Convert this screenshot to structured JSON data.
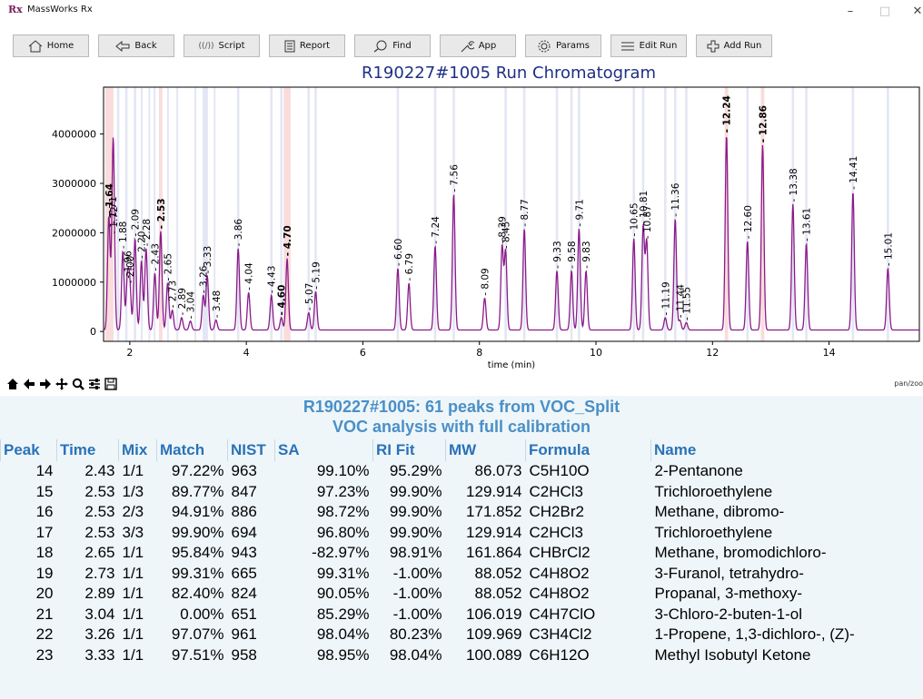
{
  "window": {
    "app_icon": "Rx",
    "title": "MassWorks Rx",
    "controls": {
      "minimize": "–",
      "maximize": "□",
      "close": "✕"
    }
  },
  "toolbar": {
    "buttons": [
      {
        "label": "Home",
        "icon": "home-icon"
      },
      {
        "label": "Back",
        "icon": "back-arrow-icon"
      },
      {
        "label": "Script",
        "icon": "script-icon"
      },
      {
        "label": "Report",
        "icon": "report-icon"
      },
      {
        "label": "Find",
        "icon": "search-icon"
      },
      {
        "label": "App",
        "icon": "wrench-icon"
      },
      {
        "label": "Params",
        "icon": "gear-icon"
      },
      {
        "label": "Edit Run",
        "icon": "list-icon"
      },
      {
        "label": "Add Run",
        "icon": "plus-icon"
      }
    ]
  },
  "chart": {
    "title": "R190227#1005 Run Chromatogram",
    "colors": {
      "trace": "#8b1a8b",
      "blue_band": "#e3e6f4",
      "red_band": "#fadcdc"
    }
  },
  "chart_data": {
    "type": "line",
    "title": "R190227#1005 Run Chromatogram",
    "xlabel": "time (min)",
    "ylabel": "",
    "xlim": [
      1.55,
      15.55
    ],
    "ylim": [
      -200000,
      4950000
    ],
    "x_ticks": [
      2,
      4,
      6,
      8,
      10,
      12,
      14
    ],
    "y_ticks": [
      0,
      1000000,
      2000000,
      3000000,
      4000000
    ],
    "y_tick_labels": [
      "0",
      "1000000",
      "2000000",
      "3000000",
      "4000000"
    ],
    "grid": false,
    "legend": "none",
    "peaks": [
      {
        "label": "1.64",
        "t": 1.64,
        "h": 2300000,
        "bold": true
      },
      {
        "label": "1.71",
        "t": 1.71,
        "h": 2100000
      },
      {
        "label": "1.72",
        "t": 1.72,
        "h": 1900000
      },
      {
        "label": "1.88",
        "t": 1.88,
        "h": 1600000
      },
      {
        "label": "1.96",
        "t": 1.96,
        "h": 1000000
      },
      {
        "label": "2.00",
        "t": 2.0,
        "h": 900000
      },
      {
        "label": "2.09",
        "t": 2.09,
        "h": 1850000
      },
      {
        "label": "2.20",
        "t": 2.2,
        "h": 1400000
      },
      {
        "label": "2.28",
        "t": 2.28,
        "h": 1650000
      },
      {
        "label": "2.43",
        "t": 2.43,
        "h": 1150000
      },
      {
        "label": "2.53",
        "t": 2.53,
        "h": 2000000,
        "bold": true
      },
      {
        "label": "2.65",
        "t": 2.65,
        "h": 950000
      },
      {
        "label": "2.73",
        "t": 2.73,
        "h": 400000
      },
      {
        "label": "2.89",
        "t": 2.89,
        "h": 250000
      },
      {
        "label": "3.04",
        "t": 3.04,
        "h": 180000
      },
      {
        "label": "3.26",
        "t": 3.26,
        "h": 700000
      },
      {
        "label": "3.33",
        "t": 3.33,
        "h": 1100000
      },
      {
        "label": "3.48",
        "t": 3.48,
        "h": 200000
      },
      {
        "label": "3.86",
        "t": 3.86,
        "h": 1650000
      },
      {
        "label": "4.04",
        "t": 4.04,
        "h": 760000
      },
      {
        "label": "4.43",
        "t": 4.43,
        "h": 700000
      },
      {
        "label": "4.60",
        "t": 4.6,
        "h": 250000,
        "bold": true
      },
      {
        "label": "4.70",
        "t": 4.7,
        "h": 1450000,
        "bold": true
      },
      {
        "label": "5.07",
        "t": 5.07,
        "h": 350000
      },
      {
        "label": "5.19",
        "t": 5.19,
        "h": 780000
      },
      {
        "label": "6.60",
        "t": 6.6,
        "h": 1250000
      },
      {
        "label": "6.79",
        "t": 6.79,
        "h": 950000
      },
      {
        "label": "7.24",
        "t": 7.24,
        "h": 1700000
      },
      {
        "label": "7.56",
        "t": 7.56,
        "h": 2750000
      },
      {
        "label": "8.09",
        "t": 8.09,
        "h": 650000
      },
      {
        "label": "8.39",
        "t": 8.39,
        "h": 1700000
      },
      {
        "label": "8.45",
        "t": 8.45,
        "h": 1600000
      },
      {
        "label": "8.77",
        "t": 8.77,
        "h": 2050000
      },
      {
        "label": "9.33",
        "t": 9.33,
        "h": 1200000
      },
      {
        "label": "9.58",
        "t": 9.58,
        "h": 1200000
      },
      {
        "label": "9.71",
        "t": 9.71,
        "h": 2050000
      },
      {
        "label": "9.83",
        "t": 9.83,
        "h": 1200000
      },
      {
        "label": "10.65",
        "t": 10.65,
        "h": 1850000
      },
      {
        "label": "10.81",
        "t": 10.81,
        "h": 2100000
      },
      {
        "label": "10.87",
        "t": 10.87,
        "h": 1800000
      },
      {
        "label": "11.19",
        "t": 11.19,
        "h": 250000
      },
      {
        "label": "11.36",
        "t": 11.36,
        "h": 2250000
      },
      {
        "label": "11.44",
        "t": 11.44,
        "h": 200000
      },
      {
        "label": "11.55",
        "t": 11.55,
        "h": 150000
      },
      {
        "label": "12.24",
        "t": 12.24,
        "h": 3950000,
        "bold": true
      },
      {
        "label": "12.60",
        "t": 12.6,
        "h": 1800000
      },
      {
        "label": "12.86",
        "t": 12.86,
        "h": 3750000,
        "bold": true
      },
      {
        "label": "13.38",
        "t": 13.38,
        "h": 2550000
      },
      {
        "label": "13.61",
        "t": 13.61,
        "h": 1750000
      },
      {
        "label": "14.41",
        "t": 14.41,
        "h": 2800000
      },
      {
        "label": "15.01",
        "t": 15.01,
        "h": 1250000
      }
    ],
    "blue_bands": [
      [
        1.62,
        1.66
      ],
      [
        1.78,
        1.82
      ],
      [
        1.92,
        1.96
      ],
      [
        2.07,
        2.11
      ],
      [
        2.19,
        2.22
      ],
      [
        2.32,
        2.35
      ],
      [
        2.41,
        2.44
      ],
      [
        2.64,
        2.67
      ],
      [
        2.8,
        2.83
      ],
      [
        3.11,
        3.14
      ],
      [
        3.25,
        3.34
      ],
      [
        3.44,
        3.47
      ],
      [
        3.84,
        3.88
      ],
      [
        4.41,
        4.45
      ],
      [
        4.58,
        4.62
      ],
      [
        5.05,
        5.09
      ],
      [
        5.17,
        5.21
      ],
      [
        6.58,
        6.62
      ],
      [
        7.22,
        7.26
      ],
      [
        7.54,
        7.58
      ],
      [
        8.43,
        8.47
      ],
      [
        8.75,
        8.79
      ],
      [
        9.31,
        9.35
      ],
      [
        9.56,
        9.6
      ],
      [
        9.69,
        9.73
      ],
      [
        10.63,
        10.67
      ],
      [
        10.79,
        10.83
      ],
      [
        11.17,
        11.21
      ],
      [
        11.34,
        11.38
      ],
      [
        11.53,
        11.57
      ],
      [
        12.58,
        12.62
      ],
      [
        13.36,
        13.4
      ],
      [
        13.59,
        13.63
      ],
      [
        14.39,
        14.43
      ],
      [
        14.99,
        15.03
      ]
    ],
    "red_bands": [
      [
        1.58,
        1.72
      ],
      [
        2.5,
        2.56
      ],
      [
        4.64,
        4.76
      ],
      [
        12.21,
        12.27
      ],
      [
        12.83,
        12.89
      ]
    ]
  },
  "plot_toolbar": {
    "buttons": [
      "home-icon",
      "back-arrow-icon",
      "forward-arrow-icon",
      "pan-icon",
      "zoom-icon",
      "configure-icon",
      "save-icon"
    ],
    "mode_text": "pan/zoo"
  },
  "summary": {
    "line1": "R190227#1005: 61 peaks from VOC_Split",
    "line2": "VOC analysis with full calibration"
  },
  "table": {
    "columns": [
      "Peak",
      "Time",
      "Mix",
      "Match",
      "NIST",
      "SA",
      "RI Fit",
      "MW",
      "Formula",
      "Name"
    ],
    "rows": [
      [
        "14",
        "2.43",
        "1/1",
        "97.22%",
        "963",
        "99.10%",
        "95.29%",
        "86.073",
        "C5H10O",
        "2-Pentanone"
      ],
      [
        "15",
        "2.53",
        "1/3",
        "89.77%",
        "847",
        "97.23%",
        "99.90%",
        "129.914",
        "C2HCl3",
        "Trichloroethylene"
      ],
      [
        "16",
        "2.53",
        "2/3",
        "94.91%",
        "886",
        "98.72%",
        "99.90%",
        "171.852",
        "CH2Br2",
        "Methane, dibromo-"
      ],
      [
        "17",
        "2.53",
        "3/3",
        "99.90%",
        "694",
        "96.80%",
        "99.90%",
        "129.914",
        "C2HCl3",
        "Trichloroethylene"
      ],
      [
        "18",
        "2.65",
        "1/1",
        "95.84%",
        "943",
        "-82.97%",
        "98.91%",
        "161.864",
        "CHBrCl2",
        "Methane, bromodichloro-"
      ],
      [
        "19",
        "2.73",
        "1/1",
        "99.31%",
        "665",
        "99.31%",
        "-1.00%",
        "88.052",
        "C4H8O2",
        "3-Furanol, tetrahydro-"
      ],
      [
        "20",
        "2.89",
        "1/1",
        "82.40%",
        "824",
        "90.05%",
        "-1.00%",
        "88.052",
        "C4H8O2",
        "Propanal, 3-methoxy-"
      ],
      [
        "21",
        "3.04",
        "1/1",
        "0.00%",
        "651",
        "85.29%",
        "-1.00%",
        "106.019",
        "C4H7ClO",
        "3-Chloro-2-buten-1-ol"
      ],
      [
        "22",
        "3.26",
        "1/1",
        "97.07%",
        "961",
        "98.04%",
        "80.23%",
        "109.969",
        "C3H4Cl2",
        "1-Propene, 1,3-dichloro-, (Z)-"
      ],
      [
        "23",
        "3.33",
        "1/1",
        "97.51%",
        "958",
        "98.95%",
        "98.04%",
        "100.089",
        "C6H12O",
        "Methyl Isobutyl Ketone"
      ]
    ]
  }
}
